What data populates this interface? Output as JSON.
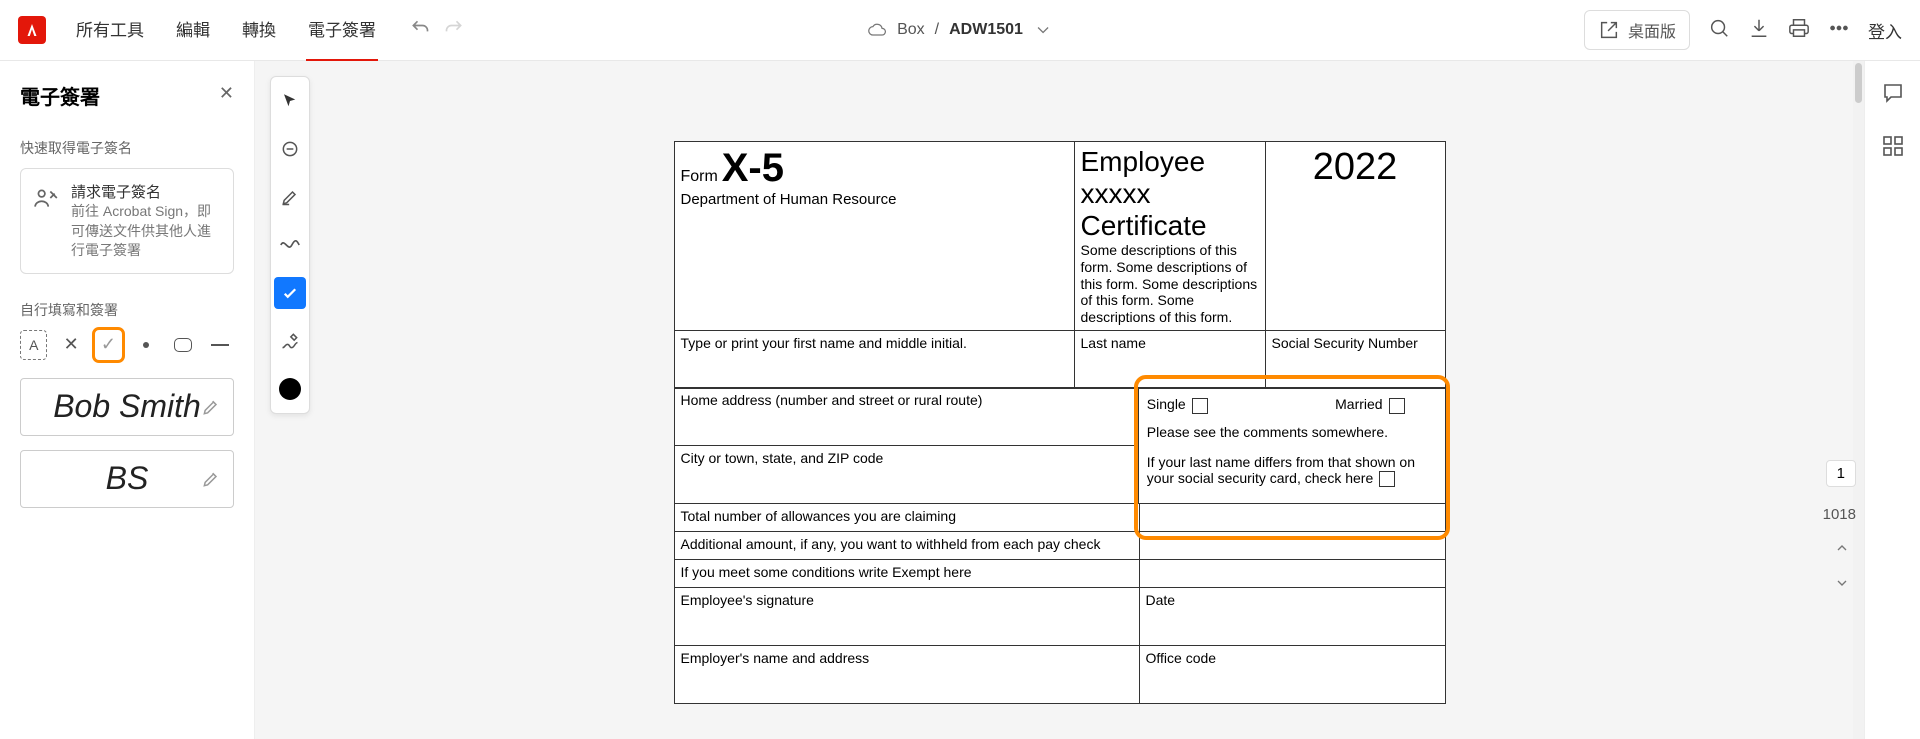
{
  "topbar": {
    "menu": [
      "所有工具",
      "編輯",
      "轉換",
      "電子簽署"
    ],
    "activeIndex": 3,
    "breadcrumb_source": "Box",
    "breadcrumb_sep": "/",
    "docname": "ADW1501",
    "desktop_label": "桌面版",
    "login_label": "登入"
  },
  "panel": {
    "title": "電子簽署",
    "section1_label": "快速取得電子簽名",
    "request_title": "請求電子簽名",
    "request_desc": "前往 Acrobat Sign，即可傳送文件供其他人進行電子簽署",
    "section2_label": "自行填寫和簽署",
    "signature_full": "Bob Smith",
    "signature_initials": "BS"
  },
  "form": {
    "form_word": "Form",
    "form_code": "X-5",
    "dept": "Department of Human Resource",
    "title": "Employee xxxxx Certificate",
    "desc": "Some descriptions of this form. Some descriptions of this form. Some descriptions of this form. Some descriptions of this form.",
    "year": "2022",
    "row_firstname": "Type or print your first name and middle initial.",
    "row_lastname": "Last name",
    "row_ssn": "Social Security Number",
    "row_address": "Home address (number and street or rural route)",
    "single_label": "Single",
    "married_label": "Married",
    "comments_note": "Please see the comments somewhere.",
    "row_city": "City or town, state, and ZIP code",
    "lastname_diff": "If your last name differs from that shown on your social security card, check here",
    "row_allow": "Total number of allowances you are claiming",
    "row_additional": "Additional amount, if any, you want to withheld from each pay check",
    "row_exempt": "If you meet some conditions write Exempt here",
    "row_emp_sig": "Employee's signature",
    "row_date": "Date",
    "row_employer": "Employer's name and address",
    "row_office": "Office code"
  },
  "pager": {
    "current": "1",
    "total": "1018"
  }
}
